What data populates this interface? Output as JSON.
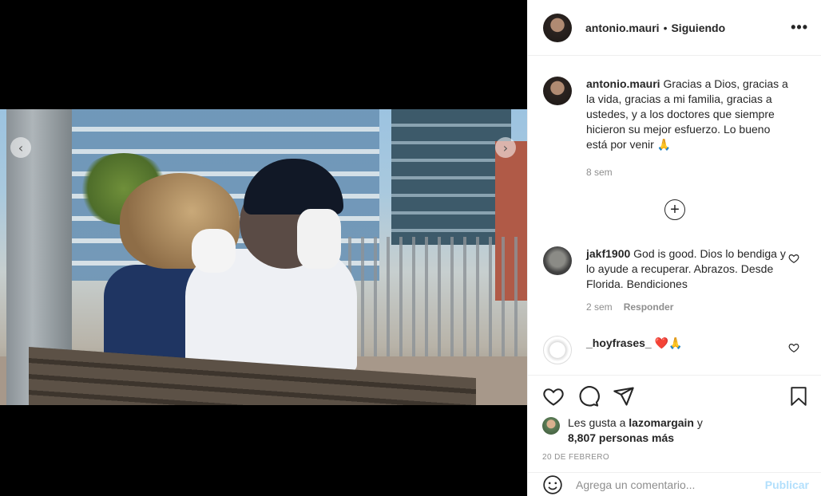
{
  "post": {
    "username": "antonio.mauri",
    "separator": "•",
    "follow_status": "Siguiendo",
    "more_icon": "more-horizontal-icon"
  },
  "caption": {
    "username": "antonio.mauri",
    "text": "Gracias a Dios, gracias a la vida, gracias a mi familia, gracias a ustedes, y a los doctores que siempre hicieron su mejor esfuerzo. Lo bueno está por venir 🙏",
    "time": "8 sem"
  },
  "comments": [
    {
      "username": "jakf1900",
      "text": "God is good. Dios lo bendiga y lo ayude a recuperar. Abrazos. Desde Florida. Bendiciones",
      "time": "2 sem",
      "reply": "Responder"
    },
    {
      "username": "_hoyfrases_",
      "text": "❤️🙏"
    }
  ],
  "likes": {
    "prefix": "Les gusta a",
    "user": "lazomargain",
    "connector": "y",
    "count_text": "8,807 personas más"
  },
  "date": "20 DE FEBRERO",
  "add_comment": {
    "placeholder": "Agrega un comentario...",
    "publish": "Publicar"
  },
  "colors": {
    "accent": "#0095f6",
    "publish_disabled": "#b2dffc",
    "heart_red": "#ed4956"
  }
}
